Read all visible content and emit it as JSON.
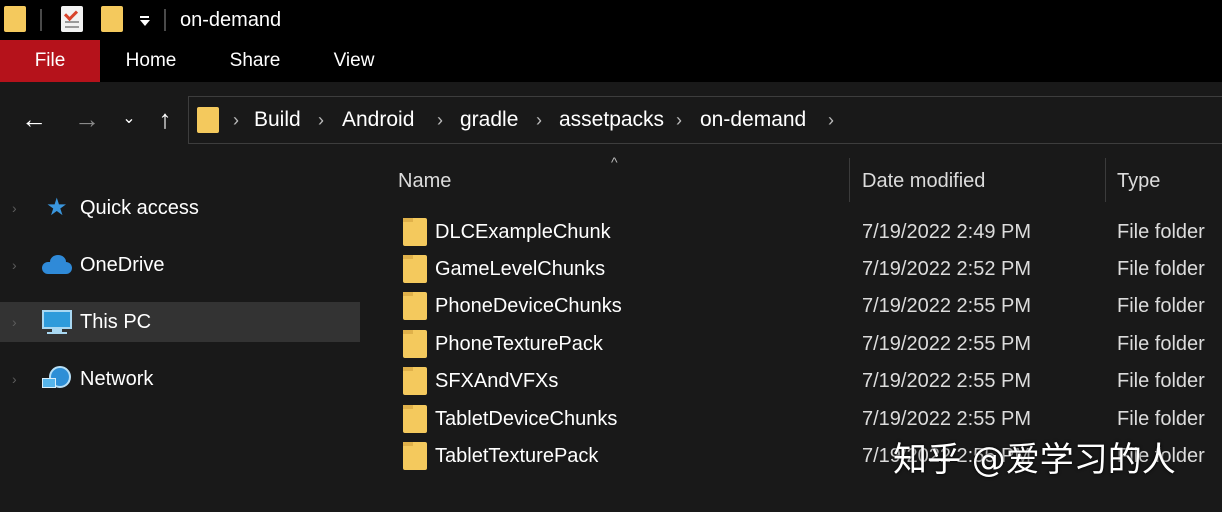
{
  "window": {
    "title": "on-demand"
  },
  "ribbon": {
    "tabs": [
      {
        "label": "File"
      },
      {
        "label": "Home"
      },
      {
        "label": "Share"
      },
      {
        "label": "View"
      }
    ],
    "file_tab_color": "#b5121b"
  },
  "navigation": {
    "back_icon": "arrow-left-icon",
    "forward_icon": "arrow-right-icon",
    "recent_icon": "chevron-down-icon",
    "up_icon": "arrow-up-icon"
  },
  "address": {
    "breadcrumbs": [
      "Build",
      "Android",
      "gradle",
      "assetpacks",
      "on-demand"
    ]
  },
  "sidebar": {
    "items": [
      {
        "label": "Quick access",
        "icon": "star-icon"
      },
      {
        "label": "OneDrive",
        "icon": "cloud-icon"
      },
      {
        "label": "This PC",
        "icon": "computer-icon",
        "selected": true
      },
      {
        "label": "Network",
        "icon": "network-icon"
      }
    ]
  },
  "file_list": {
    "columns": {
      "name": "Name",
      "date": "Date modified",
      "type": "Type"
    },
    "sort_indicator": "^",
    "rows": [
      {
        "name": "DLCExampleChunk",
        "date": "7/19/2022 2:49 PM",
        "type": "File folder"
      },
      {
        "name": "GameLevelChunks",
        "date": "7/19/2022 2:52 PM",
        "type": "File folder"
      },
      {
        "name": "PhoneDeviceChunks",
        "date": "7/19/2022 2:55 PM",
        "type": "File folder"
      },
      {
        "name": "PhoneTexturePack",
        "date": "7/19/2022 2:55 PM",
        "type": "File folder"
      },
      {
        "name": "SFXAndVFXs",
        "date": "7/19/2022 2:55 PM",
        "type": "File folder"
      },
      {
        "name": "TabletDeviceChunks",
        "date": "7/19/2022 2:55 PM",
        "type": "File folder"
      },
      {
        "name": "TabletTexturePack",
        "date": "7/19/2022 2:55 PM",
        "type": "File folder"
      }
    ]
  },
  "watermark": {
    "text": "知乎 @爱学习的人"
  },
  "colors": {
    "folder": "#f4c95d",
    "background": "#191919",
    "selected_row": "#333333",
    "accent_blue": "#3a96dd"
  }
}
